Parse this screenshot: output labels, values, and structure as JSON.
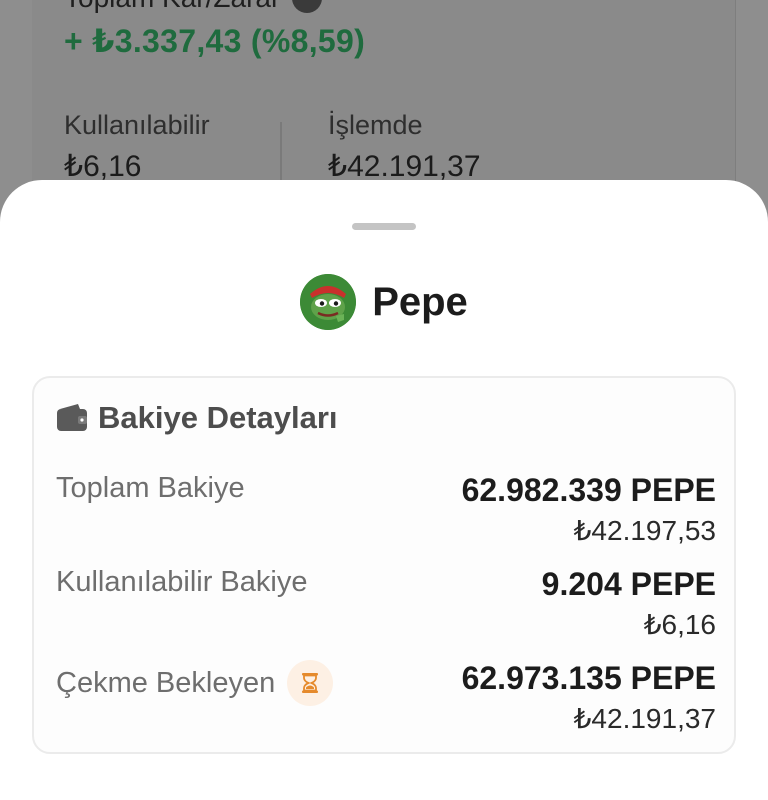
{
  "background": {
    "title": "Toplam Kar/Zarar",
    "pnl": "+ ₺3.337,43 (%8,59)",
    "available_label": "Kullanılabilir",
    "available_value": "₺6,16",
    "in_process_label": "İşlemde",
    "in_process_value": "₺42.191,37",
    "pnl_color": "#1f6b3e"
  },
  "sheet": {
    "coin_name": "Pepe",
    "coin_icon": "pepe-frog-icon",
    "card": {
      "title": "Bakiye Detayları",
      "icon": "wallet-icon",
      "rows": [
        {
          "label": "Toplam Bakiye",
          "amount": "62.982.339 PEPE",
          "fiat": "₺42.197,53"
        },
        {
          "label": "Kullanılabilir Bakiye",
          "amount": "9.204 PEPE",
          "fiat": "₺6,16"
        },
        {
          "label": "Çekme Bekleyen",
          "amount": "62.973.135 PEPE",
          "fiat": "₺42.191,37",
          "icon": "hourglass-icon"
        }
      ]
    }
  },
  "colors": {
    "accent_hourglass": "#e58a2c",
    "hourglass_bg": "#fdf0e4"
  }
}
